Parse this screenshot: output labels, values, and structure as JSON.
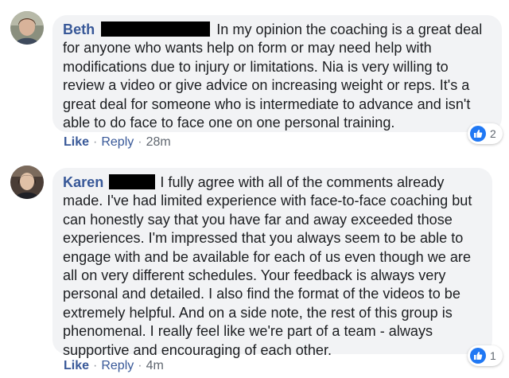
{
  "comments": [
    {
      "author": "Beth",
      "text": "In my opinion the coaching is a great deal for anyone who wants help on form or may need help with modifications due to injury or limitations. Nia is very willing to review a video or give advice on increasing weight or reps. It's a great deal for someone who is intermediate to advance and isn't able to do face to face one on one personal training.",
      "reaction_icon": "thumbs-up-icon",
      "reaction_count": "2",
      "like_label": "Like",
      "reply_label": "Reply",
      "separator": "·",
      "timestamp": "28m"
    },
    {
      "author": "Karen",
      "text": "I fully agree with all of the comments already made. I've had limited experience with face-to-face coaching but can honestly say that you have far and away exceeded those experiences. I'm impressed that you always seem to be able to engage with and be available for each of us even though we are all on very different schedules. Your feedback is always very personal and detailed. I also find the format of the videos to be extremely helpful. And on a side note, the rest of this group is phenomenal. I really feel like we're part of a team - always supportive and encouraging of each other.",
      "reaction_icon": "thumbs-up-icon",
      "reaction_count": "1",
      "like_label": "Like",
      "reply_label": "Reply",
      "separator": "·",
      "timestamp": "4m"
    }
  ],
  "colors": {
    "author_link": "#385898",
    "bubble_bg": "#f2f3f5",
    "like_badge": "#2078f4",
    "meta_text": "#606770"
  }
}
